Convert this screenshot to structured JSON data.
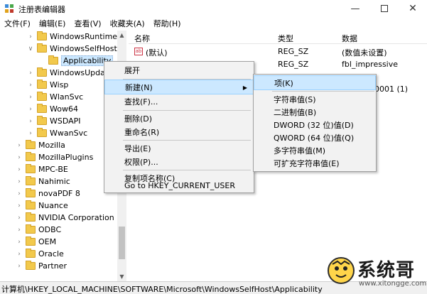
{
  "window": {
    "title": "注册表编辑器",
    "minimize_icon": "minimize-icon",
    "maximize_icon": "maximize-icon",
    "close_icon": "close-icon"
  },
  "menubar": [
    "文件(F)",
    "编辑(E)",
    "查看(V)",
    "收藏夹(A)",
    "帮助(H)"
  ],
  "tree": {
    "items": [
      {
        "label": "WindowsRuntime",
        "expander": ">"
      },
      {
        "label": "WindowsSelfHost",
        "expander": "v"
      },
      {
        "label": "Applicability",
        "expander": "",
        "selected": true
      },
      {
        "label": "WindowsUpdat",
        "expander": ">"
      },
      {
        "label": "Wisp",
        "expander": ">"
      },
      {
        "label": "WlanSvc",
        "expander": ">"
      },
      {
        "label": "Wow64",
        "expander": ">"
      },
      {
        "label": "WSDAPI",
        "expander": ">"
      },
      {
        "label": "WwanSvc",
        "expander": ">"
      },
      {
        "label": "Mozilla",
        "expander": ">"
      },
      {
        "label": "MozillaPlugins",
        "expander": ">"
      },
      {
        "label": "MPC-BE",
        "expander": ">"
      },
      {
        "label": "Nahimic",
        "expander": ">"
      },
      {
        "label": "novaPDF 8",
        "expander": ">"
      },
      {
        "label": "Nuance",
        "expander": ">"
      },
      {
        "label": "NVIDIA Corporation",
        "expander": ">"
      },
      {
        "label": "ODBC",
        "expander": ">"
      },
      {
        "label": "OEM",
        "expander": ">"
      },
      {
        "label": "Oracle",
        "expander": ">"
      },
      {
        "label": "Partner",
        "expander": ">"
      }
    ]
  },
  "list": {
    "headers": {
      "name": "名称",
      "type": "类型",
      "data": "数据"
    },
    "rows": [
      {
        "name": "(默认)",
        "type": "REG_SZ",
        "data": "(数值未设置)"
      },
      {
        "name": "",
        "type": "REG_SZ",
        "data": "fbl_impressive"
      },
      {
        "name": "",
        "type": "",
        "data": "0001 (1)"
      }
    ]
  },
  "context_menu": {
    "items": [
      "展开",
      "新建(N)",
      "查找(F)...",
      "删除(D)",
      "重命名(R)",
      "导出(E)",
      "权限(P)...",
      "复制项名称(C)",
      "Go to HKEY_CURRENT_USER"
    ],
    "highlighted": "新建(N)"
  },
  "submenu": {
    "items": [
      "项(K)",
      "字符串值(S)",
      "二进制值(B)",
      "DWORD (32 位)值(D)",
      "QWORD (64 位)值(Q)",
      "多字符串值(M)",
      "可扩充字符串值(E)"
    ],
    "highlighted": "项(K)"
  },
  "statusbar": {
    "path": "计算机\\HKEY_LOCAL_MACHINE\\SOFTWARE\\Microsoft\\WindowsSelfHost\\Applicability"
  },
  "watermark": {
    "brand": "系统哥",
    "url": "www.xitongge.com"
  },
  "colors": {
    "highlight": "#cce8ff",
    "folder": "#f2c94c",
    "menu_bg": "#f2f2f2"
  }
}
